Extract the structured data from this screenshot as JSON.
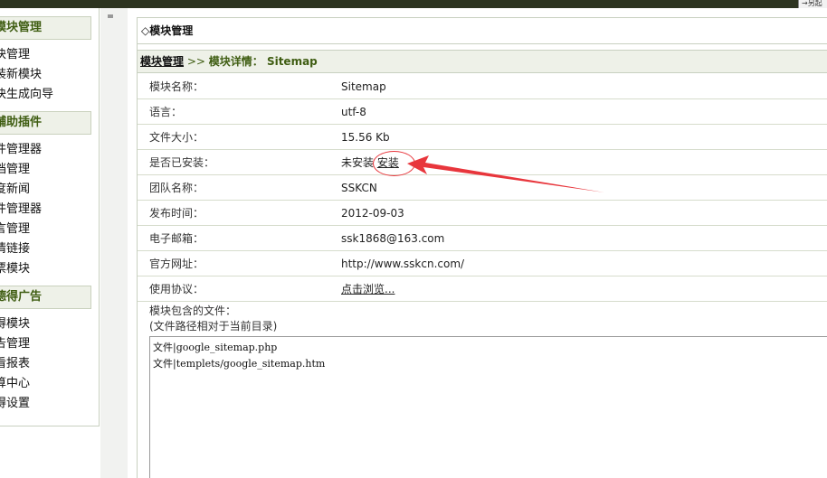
{
  "topbar": {
    "tail_text": "→另起"
  },
  "sidebar": {
    "sections": [
      {
        "title": "模块管理",
        "items": [
          "块管理",
          "装新模块",
          "块生成向导"
        ]
      },
      {
        "title": "辅助插件",
        "items": [
          "件管理器",
          "档管理",
          "度新闻",
          "件管理器",
          "言管理",
          "情链接",
          "票模块"
        ]
      },
      {
        "title": "德得广告",
        "items": [
          "得模块",
          "告管理",
          "看报表",
          "算中心",
          "得设置"
        ]
      }
    ]
  },
  "main": {
    "title": "◇模块管理",
    "breadcrumb": {
      "link": "模块管理",
      "separator": " >> ",
      "current": "模块详情： Sitemap"
    },
    "rows": [
      {
        "label": "模块名称：",
        "value": "Sitemap"
      },
      {
        "label": "语言：",
        "value": "utf-8"
      },
      {
        "label": "文件大小：",
        "value": "15.56 Kb"
      },
      {
        "label": "是否已安装：",
        "value": "未安装",
        "link": "安装"
      },
      {
        "label": "团队名称：",
        "value": "SSKCN"
      },
      {
        "label": "发布时间：",
        "value": "2012-09-03"
      },
      {
        "label": "电子邮箱：",
        "value": "ssk1868@163.com"
      },
      {
        "label": "官方网址：",
        "value": "http://www.sskcn.com/"
      },
      {
        "label": "使用协议：",
        "value": "",
        "link": "点击浏览..."
      }
    ],
    "files_label_1": "模块包含的文件：",
    "files_label_2": "(文件路径相对于当前目录)",
    "files": [
      "文件|google_sitemap.php",
      "文件|templets/google_sitemap.htm"
    ]
  },
  "annotation": {
    "color": "#e8363c"
  }
}
